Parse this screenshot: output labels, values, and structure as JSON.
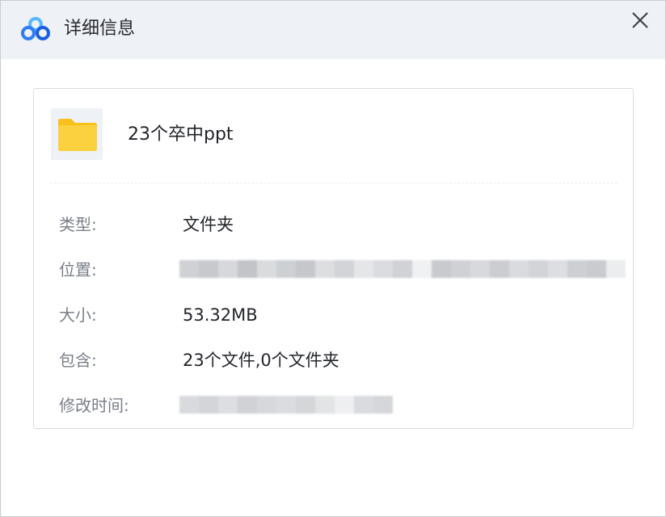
{
  "window": {
    "title": "详细信息",
    "app_icon": "baidu-netdisk-cloud-icon",
    "close_icon": "close-icon"
  },
  "file": {
    "icon": "folder-icon",
    "name": "23个卒中ppt"
  },
  "details": {
    "type_label": "类型:",
    "type_value": "文件夹",
    "location_label": "位置:",
    "location_value": "",
    "size_label": "大小:",
    "size_value": "53.32MB",
    "contains_label": "包含:",
    "contains_value": "23个文件,0个文件夹",
    "modified_label": "修改时间:",
    "modified_value": ""
  },
  "colors": {
    "folder": "#fbd13f",
    "folder_tab": "#f7c01a",
    "logo_blue": "#2f7cf6",
    "logo_light": "#55b8ff",
    "title_bar": "#eef1f5"
  }
}
